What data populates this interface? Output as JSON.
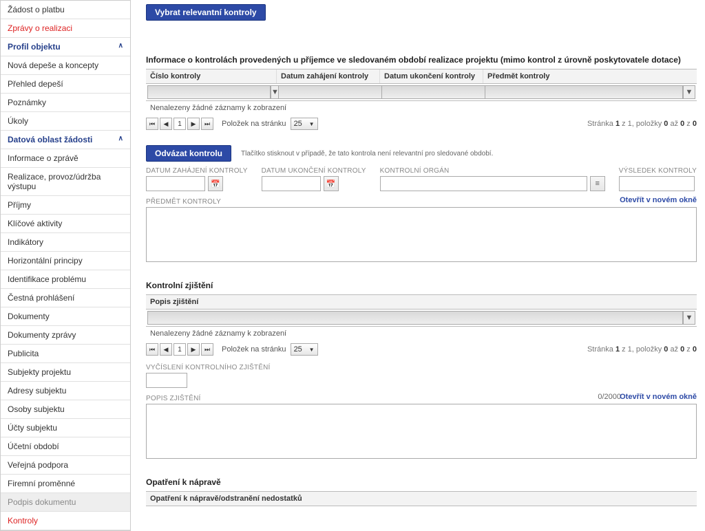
{
  "sidebar": {
    "items": [
      {
        "label": "Žádost o platbu",
        "cls": ""
      },
      {
        "label": "Zprávy o realizaci",
        "cls": "red"
      },
      {
        "label": "Profil objektu",
        "cls": "blue bold",
        "chev": true
      },
      {
        "label": "Nová depeše a koncepty",
        "cls": ""
      },
      {
        "label": "Přehled depeší",
        "cls": ""
      },
      {
        "label": "Poznámky",
        "cls": ""
      },
      {
        "label": "Úkoly",
        "cls": ""
      },
      {
        "label": "Datová oblast žádosti",
        "cls": "blue bold",
        "chev": true
      },
      {
        "label": "Informace o zprávě",
        "cls": ""
      },
      {
        "label": "Realizace, provoz/údržba výstupu",
        "cls": ""
      },
      {
        "label": "Příjmy",
        "cls": ""
      },
      {
        "label": "Klíčové aktivity",
        "cls": ""
      },
      {
        "label": "Indikátory",
        "cls": ""
      },
      {
        "label": "Horizontální principy",
        "cls": ""
      },
      {
        "label": "Identifikace problému",
        "cls": ""
      },
      {
        "label": "Čestná prohlášení",
        "cls": ""
      },
      {
        "label": "Dokumenty",
        "cls": ""
      },
      {
        "label": "Dokumenty zprávy",
        "cls": ""
      },
      {
        "label": "Publicita",
        "cls": ""
      },
      {
        "label": "Subjekty projektu",
        "cls": ""
      },
      {
        "label": "Adresy subjektu",
        "cls": ""
      },
      {
        "label": "Osoby subjektu",
        "cls": ""
      },
      {
        "label": "Účty subjektu",
        "cls": ""
      },
      {
        "label": "Účetní období",
        "cls": ""
      },
      {
        "label": "Veřejná podpora",
        "cls": ""
      },
      {
        "label": "Firemní proměnné",
        "cls": ""
      },
      {
        "label": "Podpis dokumentu",
        "cls": "grey"
      },
      {
        "label": "Kontroly",
        "cls": "red"
      }
    ]
  },
  "buttons": {
    "selectRelevant": "Vybrat relevantní kontroly",
    "unbind": "Odvázat kontrolu"
  },
  "headings": {
    "info": "Informace o kontrolách provedených u příjemce ve sledovaném období realizace projektu (mimo kontrol z úrovně poskytovatele dotace)",
    "zjisteni": "Kontrolní zjištění",
    "opatreni": "Opatření k nápravě"
  },
  "grid1": {
    "cols": {
      "cislo": "Číslo kontroly",
      "dz": "Datum zahájení kontroly",
      "du": "Datum ukončení kontroly",
      "pred": "Předmět kontroly"
    },
    "empty": "Nenalezeny žádné záznamy k zobrazení",
    "pager": {
      "label": "Položek na stránku",
      "size": "25",
      "page": "1",
      "status_pre": "Stránka ",
      "status_b1": "1",
      "status_mid1": " z 1, položky ",
      "status_b2": "0",
      "status_mid2": " až ",
      "status_b3": "0",
      "status_mid3": " z ",
      "status_b4": "0"
    }
  },
  "hint": "Tlačítko stisknout v případě, že tato kontrola není relevantní pro sledované období.",
  "form": {
    "dz": "DATUM ZAHÁJENÍ KONTROLY",
    "du": "DATUM UKONČENÍ KONTROLY",
    "organ": "KONTROLNÍ ORGÁN",
    "vysledek": "VÝSLEDEK KONTROLY",
    "predmet": "PŘEDMĚT KONTROLY",
    "openNew": "Otevřít v novém okně"
  },
  "grid2": {
    "col": "Popis zjištění",
    "empty": "Nenalezeny žádné záznamy k zobrazení",
    "pager": {
      "label": "Položek na stránku",
      "size": "25",
      "page": "1",
      "status_pre": "Stránka ",
      "status_b1": "1",
      "status_mid1": " z 1, položky ",
      "status_b2": "0",
      "status_mid2": " až ",
      "status_b3": "0",
      "status_mid3": " z ",
      "status_b4": "0"
    }
  },
  "form2": {
    "vyc": "VYČÍSLENÍ KONTROLNÍHO ZJIŠTĚNÍ",
    "popis": "POPIS ZJIŠTĚNÍ",
    "counter": "0/2000",
    "openNew": "Otevřít v novém okně"
  },
  "grid3": {
    "col": "Opatření k nápravě/odstranění nedostatků"
  }
}
